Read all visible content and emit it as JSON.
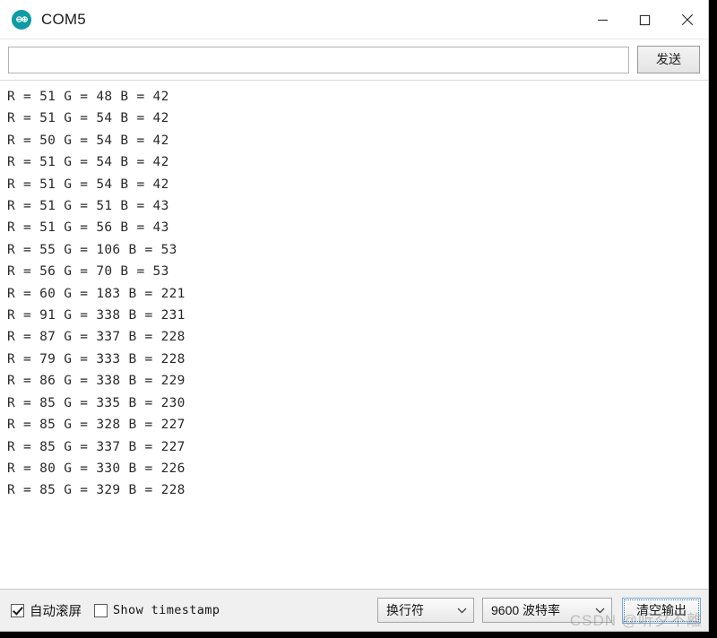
{
  "window": {
    "title": "COM5",
    "icon": "arduino-logo-icon",
    "icon_color": "#0e9ba4",
    "controls": {
      "minimize": "minimize-icon",
      "maximize": "maximize-icon",
      "close": "close-icon"
    }
  },
  "send_row": {
    "input_value": "",
    "input_placeholder": "",
    "send_label": "发送"
  },
  "output": {
    "lines": [
      "R = 51 G = 48 B = 42",
      "R = 51 G = 54 B = 42",
      "R = 50 G = 54 B = 42",
      "R = 51 G = 54 B = 42",
      "R = 51 G = 54 B = 42",
      "R = 51 G = 51 B = 43",
      "R = 51 G = 56 B = 43",
      "R = 55 G = 106 B = 53",
      "R = 56 G = 70 B = 53",
      "R = 60 G = 183 B = 221",
      "R = 91 G = 338 B = 231",
      "R = 87 G = 337 B = 228",
      "R = 79 G = 333 B = 228",
      "R = 86 G = 338 B = 229",
      "R = 85 G = 335 B = 230",
      "R = 85 G = 328 B = 227",
      "R = 85 G = 337 B = 227",
      "R = 80 G = 330 B = 226",
      "R = 85 G = 329 B = 228"
    ]
  },
  "status_bar": {
    "autoscroll": {
      "label": "自动滚屏",
      "checked": true
    },
    "timestamp": {
      "label": "Show timestamp",
      "checked": false
    },
    "newline": {
      "selected": "换行符"
    },
    "baud": {
      "selected": "9600 波特率"
    },
    "clear_label": "清空输出"
  },
  "watermark": {
    "text": "CSDN @听夕不離"
  }
}
